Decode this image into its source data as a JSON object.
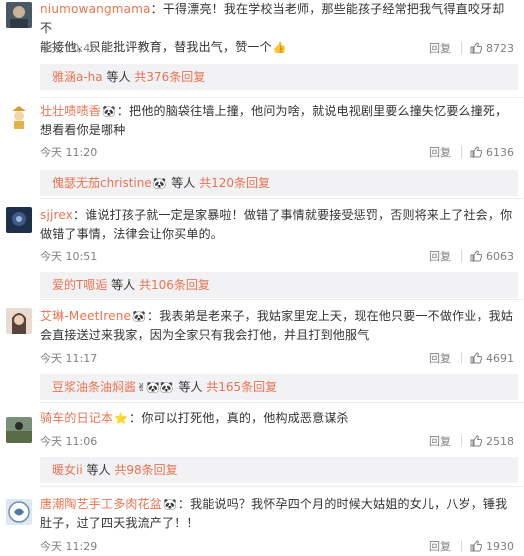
{
  "comments": [
    {
      "username": "niumowangmama",
      "sep": "：",
      "text_line1": "干得漂亮！我在学校当老师，那些能孩子经常把我气得直咬牙却不",
      "text_line2": "能接他，只能批评教育，替我出气，赞一个",
      "emoji": "👍",
      "time": "今天 10:40",
      "reply_label": "回复",
      "likes": "8723",
      "sub": {
        "user": "雅涵a-ha",
        "mid": " 等人 ",
        "more": "共376条回复"
      }
    },
    {
      "username": "壮壮啧啧香",
      "emoji_after_name": "🐼",
      "sep": "：",
      "text_line1": "把他的脑袋往墙上撞，他问为啥，就说电视剧里要么撞失忆要么撞死，",
      "text_line2": "想看看你是哪种",
      "time": "今天 11:20",
      "reply_label": "回复",
      "likes": "6136",
      "sub": {
        "user": "傀瑟无茄christine",
        "emoji": "🐼",
        "mid": " 等人 ",
        "more": "共120条回复"
      }
    },
    {
      "username": "sjjrex",
      "sep": "：",
      "text_line1": "谁说打孩子就一定是家暴啦！做错了事情就要接受惩罚，否则将来上了社会，你",
      "text_line2": "做错了事情，法律会让你买单的。",
      "time": "今天 10:51",
      "reply_label": "回复",
      "likes": "6063",
      "sub": {
        "user": "爱的T嗯逅",
        "mid": " 等人 ",
        "more": "共106条回复"
      }
    },
    {
      "username": "艾琳-MeetIrene",
      "emoji_after_name": "🐼",
      "sep": "：",
      "text_line1": "我表弟是老来子，我姑家里宠上天，现在他只要一不做作业，我姑",
      "text_line2": "会直接送过来我家，因为全家只有我会打他，并且打到他服气",
      "time": "今天 11:17",
      "reply_label": "回复",
      "likes": "4691",
      "sub": {
        "user": "豆浆油条油焖酱",
        "emoji": "✌🐼🐼",
        "mid": " 等人 ",
        "more": "共165条回复"
      }
    },
    {
      "username": "骑车的日记本",
      "emoji_after_name": "⭐",
      "sep": "：",
      "text_line1": "你可以打死他，真的，他构成恶意谋杀",
      "text_line2": "",
      "time": "今天 11:06",
      "reply_label": "回复",
      "likes": "2518",
      "sub": {
        "user": "暖女ii",
        "mid": " 等人 ",
        "more": "共98条回复"
      }
    },
    {
      "username": "唐潮陶艺手工多肉花盆",
      "emoji_after_name": "🐼",
      "sep": "：",
      "text_line1": "我能说吗？我怀孕四个月的时候大姑姐的女儿，八岁，锤我",
      "text_line2": "肚子，过了四天我流产了！！",
      "time": "今天 11:29",
      "reply_label": "回复",
      "likes": "1930"
    }
  ],
  "colors": {
    "accent": "#eb7350",
    "muted": "#808080",
    "subbg": "#f2f2f5"
  }
}
